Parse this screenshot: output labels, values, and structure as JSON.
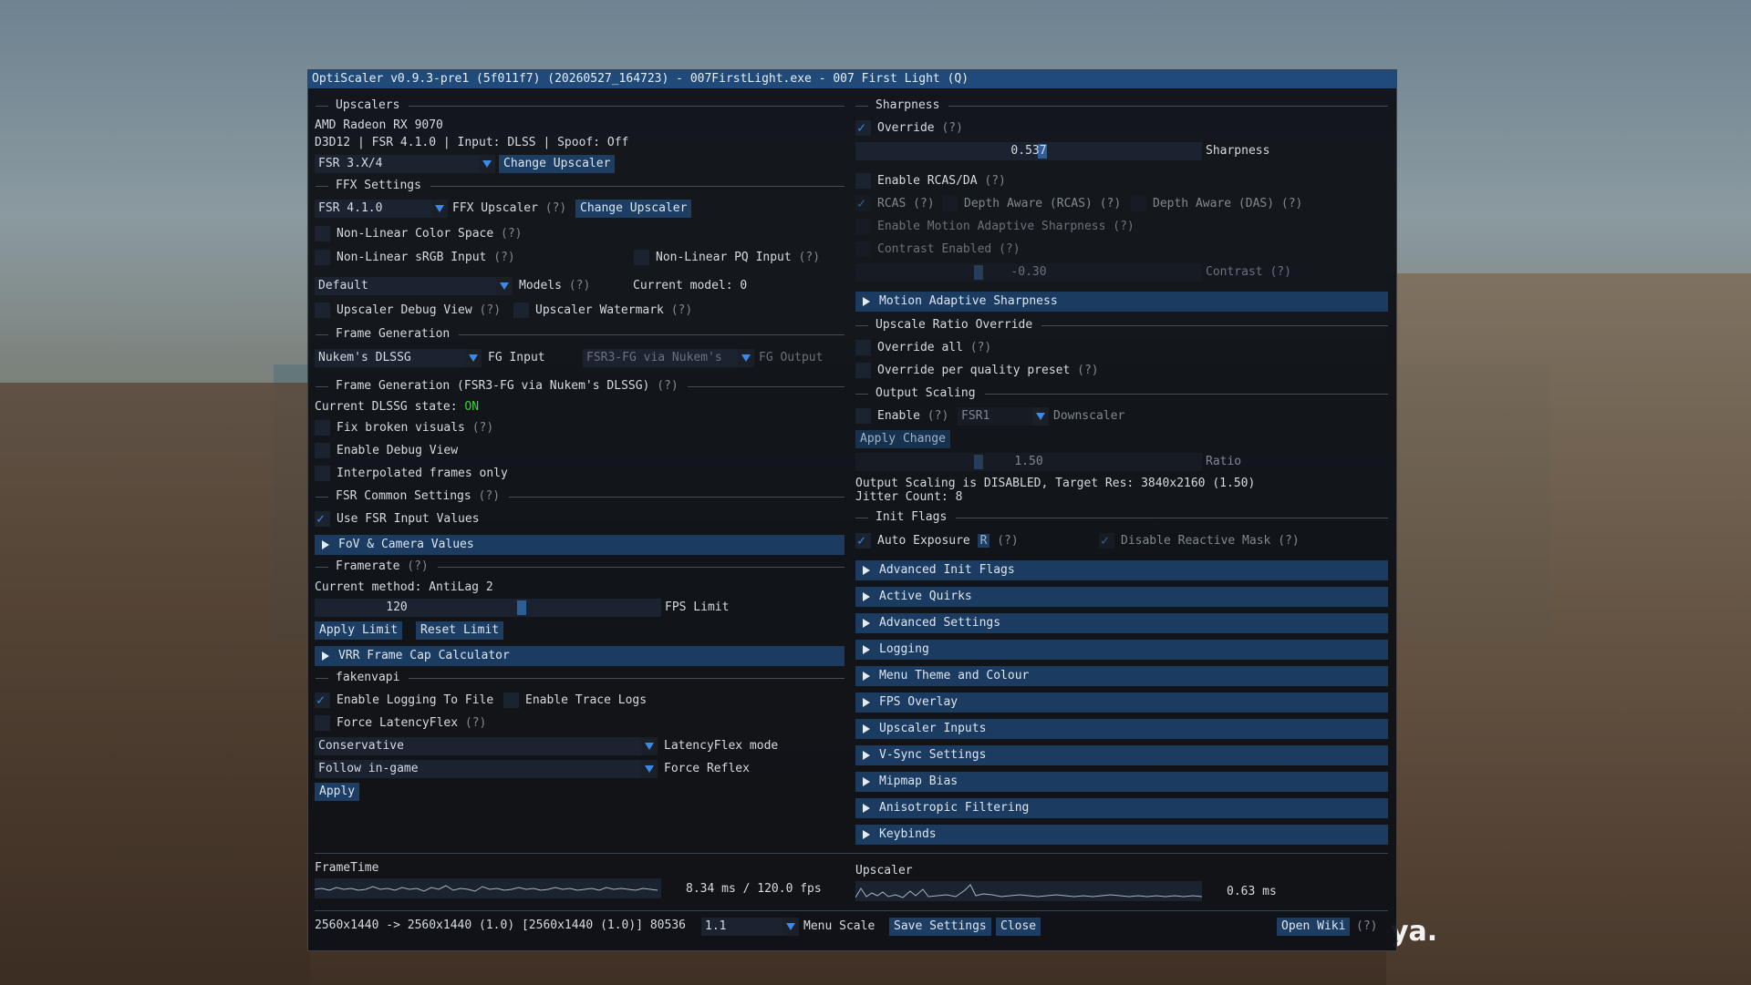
{
  "window": {
    "title": "OptiScaler v0.9.3-pre1 (5f011f7) (20260527_164723) - 007FirstLight.exe - 007 First Light (Q)"
  },
  "background_text": "ya.",
  "help": "(?)",
  "left": {
    "upscalers": {
      "header": "Upscalers",
      "gpu": "AMD Radeon RX 9070",
      "info": "D3D12 | FSR 4.1.0 | Input: DLSS | Spoof: Off",
      "combo_value": "FSR 3.X/4",
      "change_button": "Change Upscaler"
    },
    "ffx": {
      "header": "FFX Settings",
      "combo_value": "FSR 4.1.0",
      "upscaler_label": "FFX Upscaler",
      "change_button": "Change Upscaler",
      "non_linear_color": "Non-Linear Color Space",
      "non_linear_srgb": "Non-Linear sRGB Input",
      "non_linear_pq": "Non-Linear PQ Input",
      "models_combo": "Default",
      "models_label": "Models",
      "current_model": "Current model: 0",
      "debug_view": "Upscaler Debug View",
      "watermark": "Upscaler Watermark"
    },
    "framegen": {
      "header": "Frame Generation",
      "fg_input_combo": "Nukem's DLSSG",
      "fg_input_label": "FG Input",
      "fg_output_combo": "FSR3-FG via Nukem's",
      "fg_output_label": "FG Output",
      "sub_header": "Frame Generation (FSR3-FG via Nukem's DLSSG)",
      "state_label": "Current DLSSG state: ",
      "state_value": "ON",
      "fix_broken": "Fix broken visuals",
      "debug_view": "Enable Debug View",
      "interpolated_only": "Interpolated frames only"
    },
    "fsr_common": {
      "header": "FSR Common Settings",
      "use_fsr_input": "Use FSR Input Values",
      "fov_header": "FoV & Camera Values"
    },
    "framerate": {
      "header": "Framerate",
      "method": "Current method: AntiLag 2",
      "fps_value": "120",
      "fps_fraction": 0.6,
      "fps_label": "FPS Limit",
      "apply_button": "Apply Limit",
      "reset_button": "Reset Limit",
      "vrr_header": "VRR Frame Cap Calculator"
    },
    "fakenvapi": {
      "header": "fakenvapi",
      "logging": "Enable Logging To File",
      "trace_logs": "Enable Trace Logs",
      "force_latencyflex": "Force LatencyFlex",
      "latencyflex_combo": "Conservative",
      "latencyflex_label": "LatencyFlex mode",
      "reflex_combo": "Follow in-game",
      "reflex_label": "Force Reflex",
      "apply_button": "Apply"
    }
  },
  "right": {
    "sharpness": {
      "header": "Sharpness",
      "override": "Override",
      "slider_value": "0.537",
      "slider_fraction": 0.54,
      "slider_label": "Sharpness",
      "enable_rcas": "Enable RCAS/DA",
      "rcas": "RCAS",
      "depth_aware_rcas": "Depth Aware (RCAS)",
      "depth_aware_das": "Depth Aware (DAS)",
      "motion_adaptive": "Enable Motion Adaptive Sharpness",
      "contrast_enabled": "Contrast Enabled",
      "contrast_value": "-0.30",
      "contrast_fraction": 0.35,
      "contrast_label": "Contrast",
      "motion_header": "Motion Adaptive Sharpness"
    },
    "ratio_override": {
      "header": "Upscale Ratio Override",
      "override_all": "Override all",
      "per_preset": "Override per quality preset"
    },
    "output_scaling": {
      "header": "Output Scaling",
      "enable": "Enable",
      "combo_value": "FSR1",
      "downscaler_label": "Downscaler",
      "apply_button": "Apply Change",
      "ratio_value": "1.50",
      "ratio_fraction": 0.35,
      "ratio_label": "Ratio",
      "status": "Output Scaling is DISABLED, Target Res: 3840x2160 (1.50)",
      "jitter": "Jitter Count: 8"
    },
    "init_flags": {
      "header": "Init Flags",
      "auto_exposure": "Auto Exposure",
      "auto_exposure_r": "R",
      "disable_reactive": "Disable Reactive Mask"
    },
    "collapsed_headers": [
      "Advanced Init Flags",
      "Active Quirks",
      "Advanced Settings",
      "Logging",
      "Menu Theme and Colour",
      "FPS Overlay",
      "Upscaler Inputs",
      "V-Sync Settings",
      "Mipmap Bias",
      "Anisotropic Filtering",
      "Keybinds"
    ]
  },
  "footer": {
    "frametime_label": "FrameTime",
    "frametime_value": "8.34 ms /  120.0 fps",
    "upscaler_label": "Upscaler",
    "upscaler_value": "0.63 ms",
    "resolution": "2560x1440 -> 2560x1440 (1.0) [2560x1440 (1.0)] 80536",
    "menu_scale_value": "1.1",
    "menu_scale_label": "Menu Scale",
    "save_button": "Save Settings",
    "close_button": "Close",
    "wiki_button": "Open Wiki"
  },
  "colors": {
    "accent": "#3b8ae6",
    "header_bg": "#1c3b60",
    "button_bg": "#1e3d63",
    "title_bg": "#1f4a7a",
    "state_on": "#3ad23a"
  }
}
